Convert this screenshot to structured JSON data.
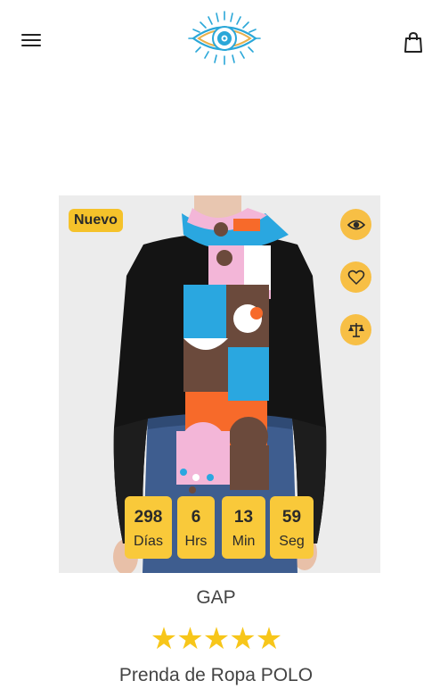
{
  "header": {
    "menu_icon": "hamburger-icon",
    "logo_icon": "evil-eye-logo",
    "cart_icon": "shopping-bag-icon"
  },
  "product": {
    "badge": "Nuevo",
    "actions": [
      "eye-icon",
      "heart-icon",
      "compare-scale-icon"
    ],
    "countdown": [
      {
        "value": "298",
        "unit": "Días"
      },
      {
        "value": "6",
        "unit": "Hrs"
      },
      {
        "value": "13",
        "unit": "Min"
      },
      {
        "value": "59",
        "unit": "Seg"
      }
    ],
    "brand": "GAP",
    "rating": 5,
    "rating_stars": "★★★★★",
    "name": "Prenda de Ropa POLO"
  },
  "colors": {
    "accent": "#f7bf45",
    "badge": "#f5c22a",
    "star": "#f7c61a",
    "logo_blue": "#2aa7d8",
    "logo_gold": "#e8b04a"
  }
}
